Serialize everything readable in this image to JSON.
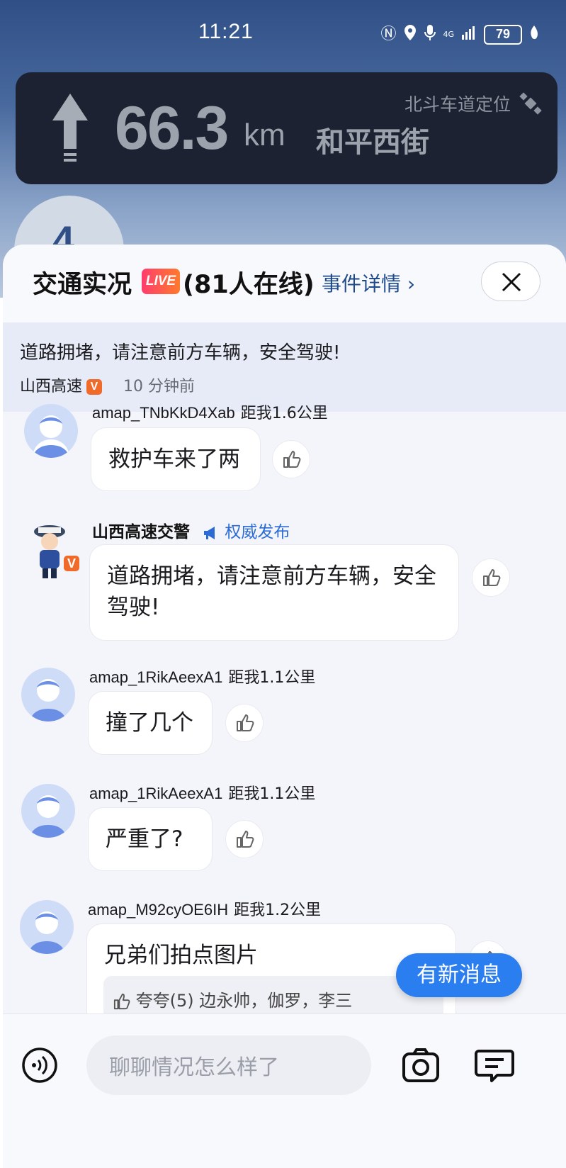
{
  "status_bar": {
    "time": "11:21",
    "network": "4G",
    "battery": "79"
  },
  "navigation": {
    "distance": "66.3",
    "unit": "km",
    "street": "和平西街",
    "positioning": "北斗车道定位",
    "lane_number": "4"
  },
  "sheet": {
    "title": "交通实况",
    "live_badge": "LIVE",
    "online": "(81人在线)",
    "event_detail": "事件详情 ›"
  },
  "notice": {
    "text": "道路拥堵，请注意前方车辆，安全驾驶!",
    "source": "山西高速",
    "badge": "V",
    "time": "10 分钟前"
  },
  "messages": [
    {
      "user": "amap_TNbKkD4Xab",
      "distance": "距我1.6公里",
      "text": "救护车来了两"
    },
    {
      "user": "山西高速交警",
      "tag": "权威发布",
      "badge": "V",
      "text": "道路拥堵，请注意前方车辆，安全驾驶!"
    },
    {
      "user": "amap_1RikAeexA1",
      "distance": "距我1.1公里",
      "text": "撞了几个"
    },
    {
      "user": "amap_1RikAeexA1",
      "distance": "距我1.1公里",
      "text": "严重了?"
    },
    {
      "user": "amap_M92cyOE6IH",
      "distance": "距我1.2公里",
      "text": "兄弟们拍点图片",
      "praise": "夸夸(5) 边永帅，伽罗，李三"
    }
  ],
  "new_message_button": "有新消息",
  "bottom_bar": {
    "input_placeholder": "聊聊情况怎么样了"
  },
  "colors": {
    "accent_blue": "#2a7ef0",
    "nav_card": "#1c2231",
    "badge_orange": "#f06a2a",
    "notice_bg": "#e7ebf7"
  }
}
